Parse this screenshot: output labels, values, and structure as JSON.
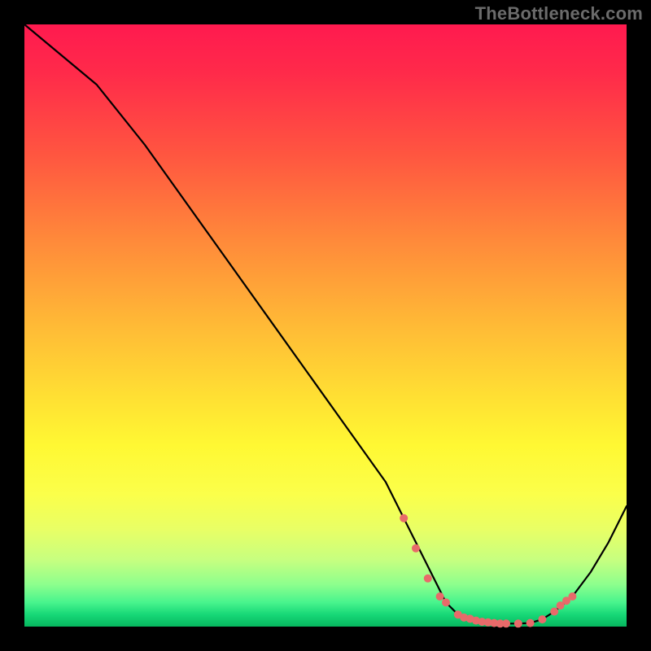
{
  "watermark": "TheBottleneck.com",
  "colors": {
    "frame_bg": "#000000",
    "curve": "#000000",
    "marker": "#e86a6a"
  },
  "chart_data": {
    "type": "line",
    "title": "",
    "xlabel": "",
    "ylabel": "",
    "xlim": [
      0,
      100
    ],
    "ylim": [
      0,
      100
    ],
    "grid": false,
    "legend": false,
    "series": [
      {
        "name": "curve",
        "x": [
          0,
          12,
          20,
          30,
          40,
          50,
          60,
          65,
          68,
          70,
          72,
          75,
          78,
          80,
          82,
          84,
          86,
          88,
          91,
          94,
          97,
          100
        ],
        "y": [
          100,
          90,
          80,
          66,
          52,
          38,
          24,
          14,
          8,
          4,
          2,
          1,
          0.6,
          0.5,
          0.5,
          0.6,
          1.2,
          2.5,
          5,
          9,
          14,
          20
        ]
      }
    ],
    "markers": {
      "name": "highlight-points",
      "x": [
        63,
        65,
        67,
        69,
        70,
        72,
        73,
        74,
        75,
        76,
        77,
        78,
        79,
        80,
        82,
        84,
        86,
        88,
        89,
        90,
        91
      ],
      "y": [
        18,
        13,
        8,
        5,
        4,
        2,
        1.5,
        1.3,
        1,
        0.8,
        0.7,
        0.6,
        0.5,
        0.5,
        0.5,
        0.6,
        1.2,
        2.5,
        3.5,
        4.3,
        5
      ]
    }
  }
}
